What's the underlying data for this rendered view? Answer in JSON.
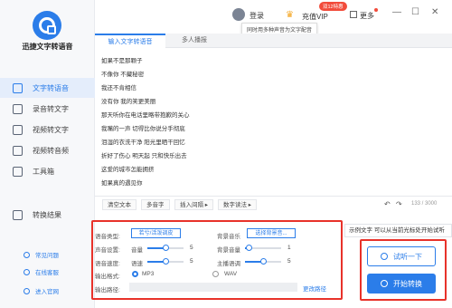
{
  "app": {
    "title": "迅捷文字转语音"
  },
  "sidebar": {
    "items": [
      {
        "label": "文字转语音",
        "icon": "text-to-speech-icon",
        "active": true
      },
      {
        "label": "录音转文字",
        "icon": "recording-icon"
      },
      {
        "label": "视频转文字",
        "icon": "video-icon"
      },
      {
        "label": "视频转音频",
        "icon": "video-audio-icon"
      },
      {
        "label": "工具箱",
        "icon": "toolbox-icon"
      },
      {
        "label": "转换结果",
        "icon": "result-icon"
      }
    ],
    "footer": [
      {
        "label": "常见问题",
        "icon": "faq-icon"
      },
      {
        "label": "在线客服",
        "icon": "service-icon"
      },
      {
        "label": "进入官网",
        "icon": "website-icon"
      }
    ]
  },
  "header": {
    "login": "登录",
    "vip": "充值VIP",
    "vip_badge": "双12特惠",
    "tooltip": "同时用多种声音为文字配音",
    "more": "更多",
    "window_controls": [
      "—",
      "☐",
      "✕"
    ]
  },
  "tabs": [
    "输入文字转语音",
    "多人播报"
  ],
  "editor": {
    "lines": [
      "如果不是那颗子",
      "不像你 不藏秘密",
      "我还不肯相信",
      "没有你 我的笑更美丽",
      "那天听你在电话里略带抱歉的关心",
      "我嘴的一声 切得比你说分手彻底",
      "泪湿的衣洗干净 阳光里晒干回忆",
      "折好了伤心 明天起 只和快乐出去",
      "这爱的城市怎能拥挤",
      "如果真的遇见你"
    ],
    "count": "133 / 3000"
  },
  "toolbar": {
    "clear": "清空文本",
    "polyphone": "多音字",
    "pause": "插入间隔 ▸",
    "digits": "数字读法 ▸",
    "undo": "↶",
    "redo": "↷"
  },
  "settings": {
    "voice_type_label": "语音类型:",
    "voice_type_value": "若兮/活泼调皮",
    "bg_music_label": "背景音乐",
    "bg_music_value": "选择背景音...",
    "sound_settings_label": "声音设置:",
    "volume_label": "音量",
    "volume_value": "5",
    "volume_level": 0.5,
    "bg_volume_label": "背景音量",
    "bg_volume_value": "1",
    "bg_volume_level": 0.1,
    "speed_label": "语音速度:",
    "rate_label": "语速",
    "rate_value": "5",
    "rate_level": 0.5,
    "pitch_label": "主播语调",
    "pitch_value": "5",
    "pitch_level": 0.5,
    "format_label": "输出格式:",
    "format_mp3": "MP3",
    "format_wav": "WAV",
    "selected_format": "MP3",
    "path_label": "输出路径:",
    "change_path": "更改路径"
  },
  "preview": {
    "label": "示例文字",
    "text": "可以从当前光标处开始试听"
  },
  "actions": {
    "listen": "试听一下",
    "convert": "开始转换"
  },
  "colors": {
    "accent": "#2b7de9",
    "highlight": "#e8322a"
  }
}
